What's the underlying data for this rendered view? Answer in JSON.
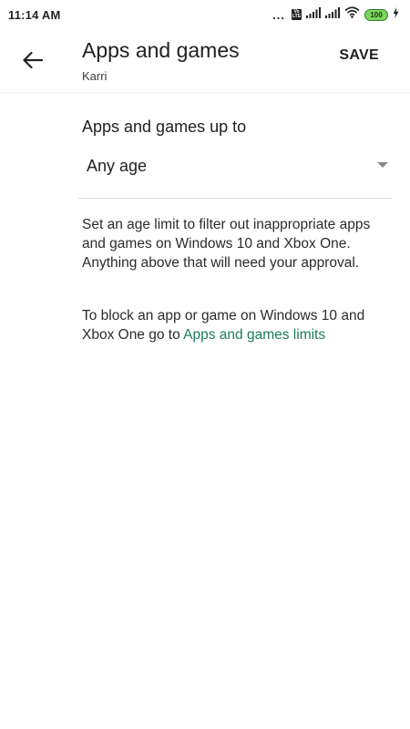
{
  "status_bar": {
    "time": "11:14 AM",
    "dots": "...",
    "volte": "Vo LTE",
    "battery": "100"
  },
  "app_bar": {
    "title": "Apps and games",
    "subtitle": "Karri",
    "save_label": "SAVE"
  },
  "content": {
    "section_label": "Apps and games up to",
    "selected_age": "Any age",
    "description": "Set an age limit to filter out inappropriate apps and games on Windows 10 and Xbox One. Anything above that will need your approval.",
    "block_text_prefix": "To block an app or game on Windows 10 and Xbox One go to ",
    "limits_link": "Apps and games limits"
  },
  "colors": {
    "link": "#1a7a5e",
    "battery": "#7bd65a"
  },
  "icons": [
    "back-arrow-icon",
    "dropdown-arrow-icon",
    "signal-icon",
    "wifi-icon",
    "battery-icon",
    "charging-icon"
  ]
}
